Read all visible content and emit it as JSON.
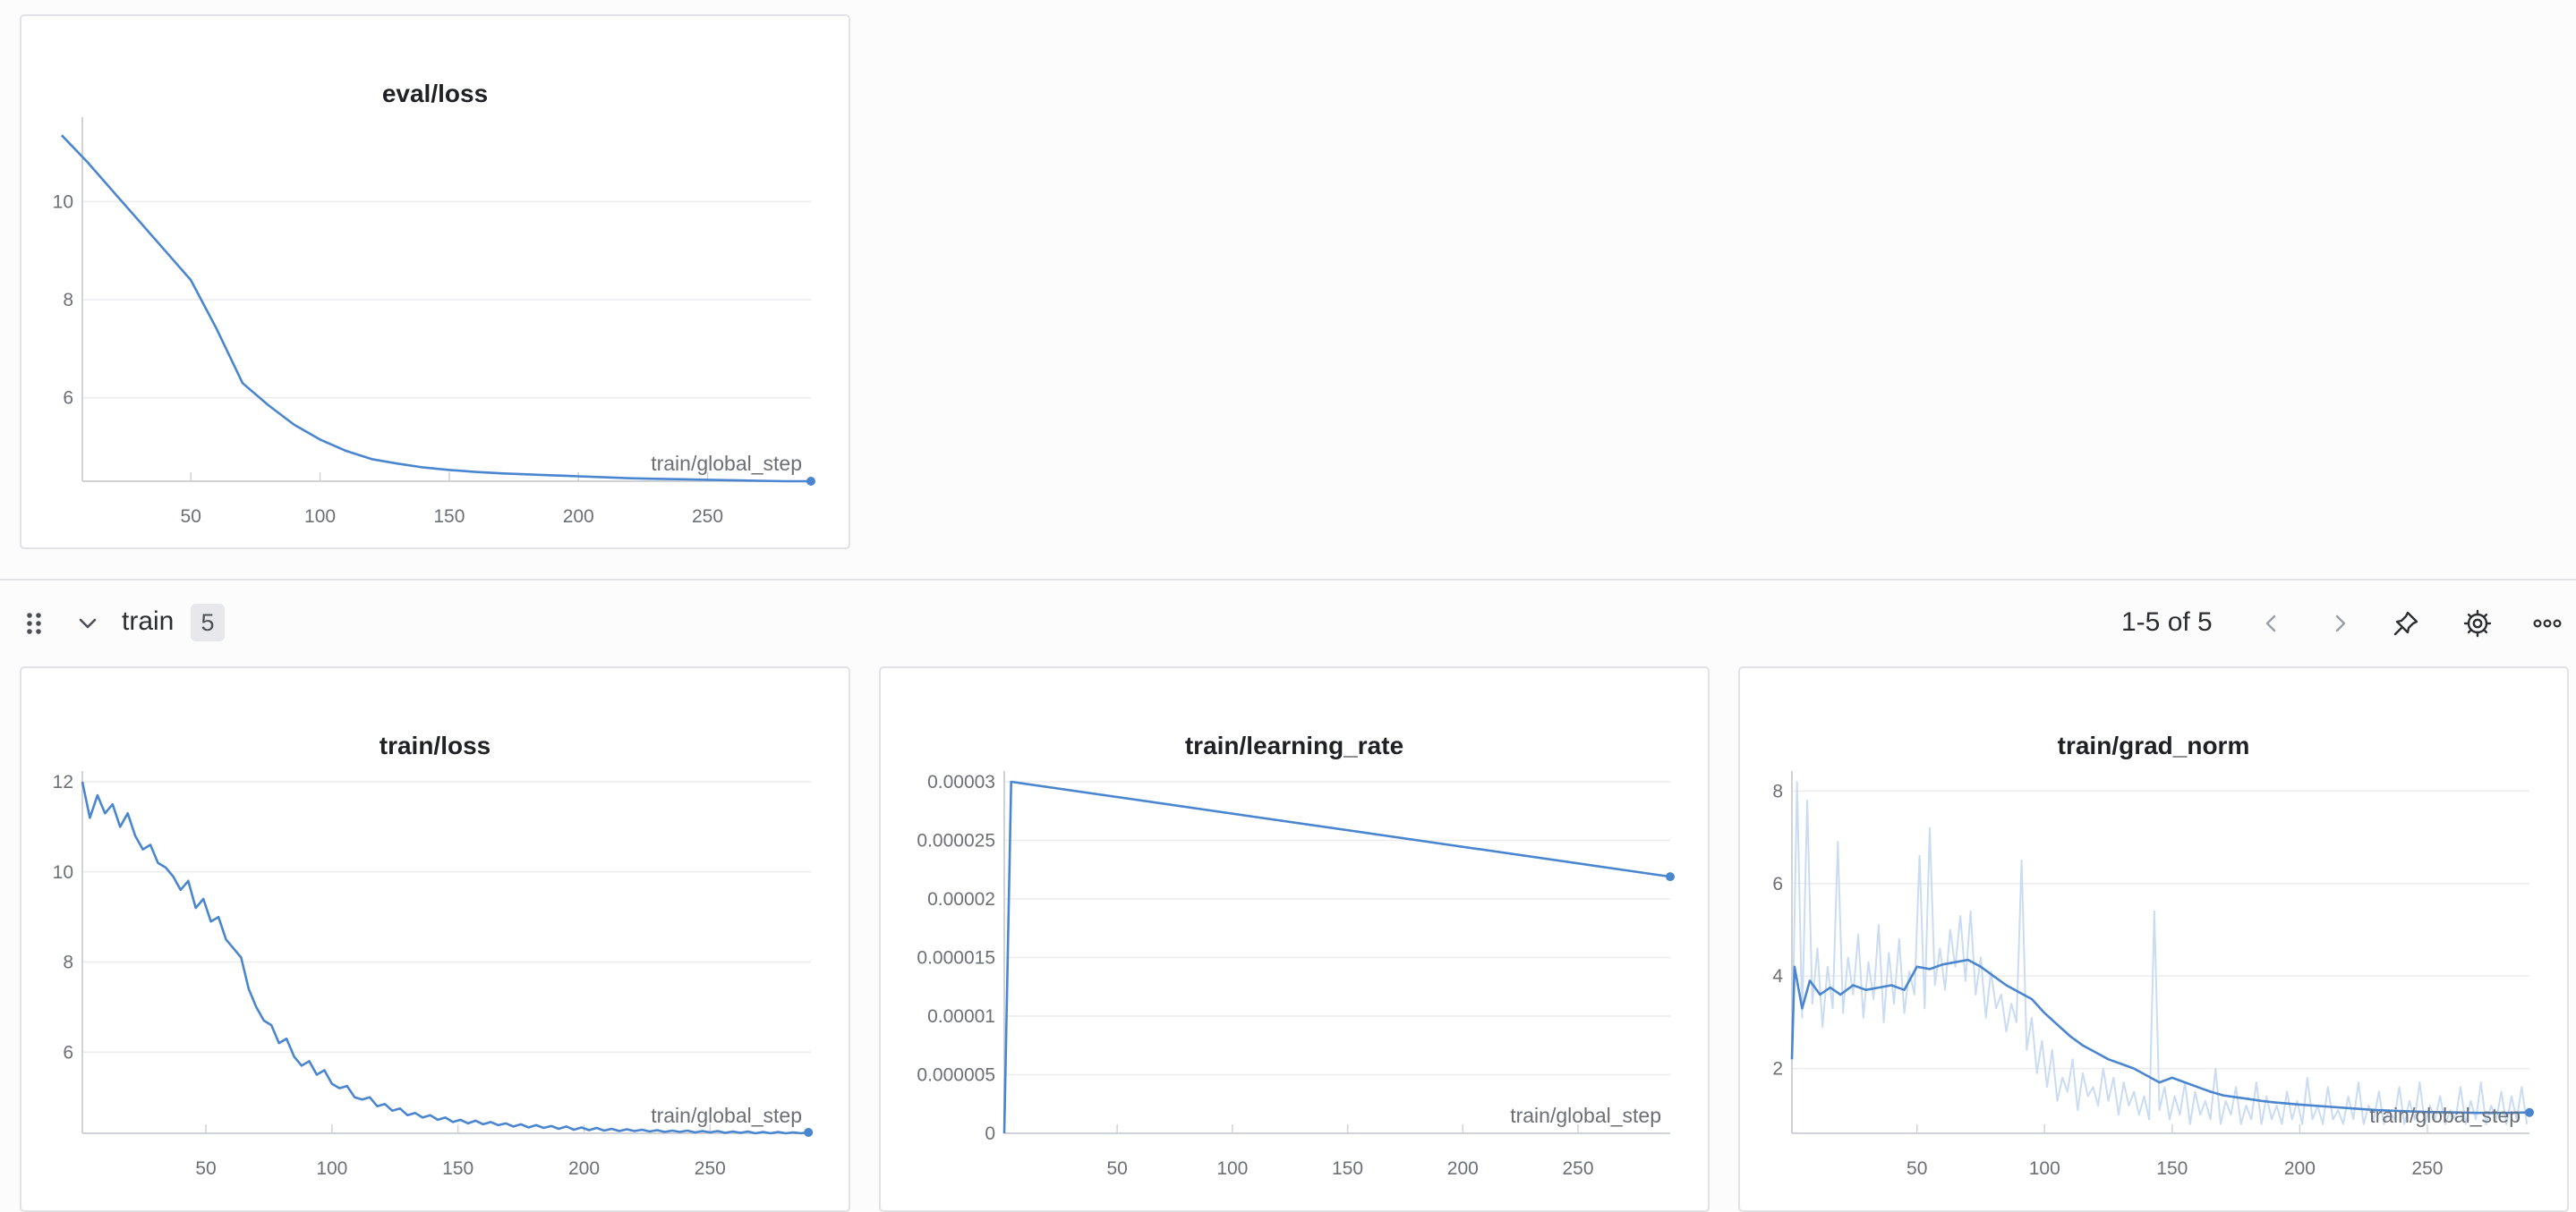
{
  "section": {
    "title": "train",
    "count": "5",
    "pagination": "1-5 of 5"
  },
  "icons": {
    "drag": "drag-handle-icon",
    "collapse": "chevron-down-icon",
    "prev": "chevron-left-icon",
    "next": "chevron-right-icon",
    "pin": "pin-icon",
    "settings": "gear-icon",
    "more": "more-horizontal-icon"
  },
  "colors": {
    "line": "#4a86cf",
    "raw_line": "#c9dcf2",
    "grid": "#ececee",
    "axis": "#cfd2d7",
    "text": "#6b6f76"
  },
  "chart_data": [
    {
      "id": "eval_loss",
      "type": "line",
      "title": "eval/loss",
      "xlabel": "train/global_step",
      "ylabel": "",
      "xlim": [
        8,
        290
      ],
      "ylim": [
        4.3,
        11.5
      ],
      "xticks": [
        50,
        100,
        150,
        200,
        250
      ],
      "yticks": [
        6,
        8,
        10
      ],
      "ytick_labels": [
        "6",
        "8",
        "10"
      ],
      "series": [
        {
          "x": [
            0,
            10,
            20,
            30,
            40,
            50,
            60,
            70,
            80,
            90,
            100,
            110,
            120,
            130,
            140,
            150,
            160,
            170,
            180,
            190,
            200,
            210,
            220,
            230,
            240,
            250,
            260,
            270,
            280,
            290
          ],
          "y": [
            11.35,
            10.8,
            10.2,
            9.6,
            9.0,
            8.4,
            7.4,
            6.3,
            5.85,
            5.45,
            5.15,
            4.92,
            4.75,
            4.66,
            4.58,
            4.53,
            4.49,
            4.46,
            4.44,
            4.42,
            4.4,
            4.38,
            4.36,
            4.35,
            4.34,
            4.33,
            4.32,
            4.31,
            4.3,
            4.3
          ]
        }
      ]
    },
    {
      "id": "train_loss",
      "type": "line",
      "title": "train/loss",
      "xlabel": "train/global_step",
      "ylabel": "",
      "xlim": [
        1,
        290
      ],
      "ylim": [
        4.2,
        12
      ],
      "xticks": [
        50,
        100,
        150,
        200,
        250
      ],
      "yticks": [
        6,
        8,
        10,
        12
      ],
      "ytick_labels": [
        "6",
        "8",
        "10",
        "12"
      ],
      "series": [
        {
          "x": [
            1,
            4,
            7,
            10,
            13,
            16,
            19,
            22,
            25,
            28,
            31,
            34,
            37,
            40,
            43,
            46,
            49,
            52,
            55,
            58,
            61,
            64,
            67,
            70,
            73,
            76,
            79,
            82,
            85,
            88,
            91,
            94,
            97,
            100,
            103,
            106,
            109,
            112,
            115,
            118,
            121,
            124,
            127,
            130,
            133,
            136,
            139,
            142,
            145,
            148,
            151,
            154,
            157,
            160,
            163,
            166,
            169,
            172,
            175,
            178,
            181,
            184,
            187,
            190,
            193,
            196,
            199,
            202,
            205,
            208,
            211,
            214,
            217,
            220,
            223,
            226,
            229,
            232,
            235,
            238,
            241,
            244,
            247,
            250,
            253,
            256,
            259,
            262,
            265,
            268,
            271,
            274,
            277,
            280,
            283,
            286,
            289
          ],
          "y": [
            12.0,
            11.2,
            11.7,
            11.3,
            11.5,
            11.0,
            11.3,
            10.8,
            10.5,
            10.6,
            10.2,
            10.1,
            9.9,
            9.6,
            9.8,
            9.2,
            9.4,
            8.9,
            9.0,
            8.5,
            8.3,
            8.1,
            7.4,
            7.0,
            6.7,
            6.6,
            6.2,
            6.3,
            5.9,
            5.7,
            5.8,
            5.5,
            5.6,
            5.3,
            5.2,
            5.25,
            5.0,
            4.95,
            5.0,
            4.8,
            4.85,
            4.7,
            4.75,
            4.6,
            4.65,
            4.55,
            4.6,
            4.5,
            4.55,
            4.45,
            4.5,
            4.42,
            4.48,
            4.4,
            4.45,
            4.38,
            4.42,
            4.35,
            4.4,
            4.33,
            4.38,
            4.32,
            4.36,
            4.3,
            4.35,
            4.28,
            4.33,
            4.27,
            4.32,
            4.26,
            4.3,
            4.25,
            4.29,
            4.25,
            4.28,
            4.24,
            4.27,
            4.23,
            4.26,
            4.23,
            4.26,
            4.22,
            4.25,
            4.22,
            4.25,
            4.21,
            4.24,
            4.21,
            4.24,
            4.2,
            4.23,
            4.2,
            4.23,
            4.2,
            4.22,
            4.2,
            4.22
          ]
        }
      ]
    },
    {
      "id": "train_learning_rate",
      "type": "line",
      "title": "train/learning_rate",
      "xlabel": "train/global_step",
      "ylabel": "",
      "xlim": [
        1,
        290
      ],
      "ylim": [
        0,
        3e-05
      ],
      "xticks": [
        50,
        100,
        150,
        200,
        250
      ],
      "yticks": [
        0,
        5e-06,
        1e-05,
        1.5e-05,
        2e-05,
        2.5e-05,
        3e-05
      ],
      "ytick_labels": [
        "0",
        "0.000005",
        "0.00001",
        "0.000015",
        "0.00002",
        "0.000025",
        "0.00003"
      ],
      "series": [
        {
          "x": [
            1,
            4,
            290
          ],
          "y": [
            0,
            3e-05,
            2.19e-05
          ]
        }
      ]
    },
    {
      "id": "train_grad_norm",
      "type": "line",
      "title": "train/grad_norm",
      "xlabel": "train/global_step",
      "ylabel": "",
      "xlim": [
        1,
        290
      ],
      "ylim": [
        0.6,
        8.2
      ],
      "xticks": [
        50,
        100,
        150,
        200,
        250
      ],
      "yticks": [
        2,
        4,
        6,
        8
      ],
      "ytick_labels": [
        "2",
        "4",
        "6",
        "8"
      ],
      "series": [
        {
          "name": "raw",
          "x": [
            1,
            3,
            5,
            7,
            9,
            11,
            13,
            15,
            17,
            19,
            21,
            23,
            25,
            27,
            29,
            31,
            33,
            35,
            37,
            39,
            41,
            43,
            45,
            47,
            49,
            51,
            53,
            55,
            57,
            59,
            61,
            63,
            65,
            67,
            69,
            71,
            73,
            75,
            77,
            79,
            81,
            83,
            85,
            87,
            89,
            91,
            93,
            95,
            97,
            99,
            101,
            103,
            105,
            107,
            109,
            111,
            113,
            115,
            117,
            119,
            121,
            123,
            125,
            127,
            129,
            131,
            133,
            135,
            137,
            139,
            141,
            143,
            145,
            147,
            149,
            151,
            153,
            155,
            157,
            159,
            161,
            163,
            165,
            167,
            169,
            171,
            173,
            175,
            177,
            179,
            181,
            183,
            185,
            187,
            189,
            191,
            193,
            195,
            197,
            199,
            201,
            203,
            205,
            207,
            209,
            211,
            213,
            215,
            217,
            219,
            221,
            223,
            225,
            227,
            229,
            231,
            233,
            235,
            237,
            239,
            241,
            243,
            245,
            247,
            249,
            251,
            253,
            255,
            257,
            259,
            261,
            263,
            265,
            267,
            269,
            271,
            273,
            275,
            277,
            279,
            281,
            283,
            285,
            287,
            289
          ],
          "y": [
            2.2,
            8.2,
            3.1,
            7.8,
            3.4,
            4.6,
            2.9,
            4.2,
            3.3,
            6.9,
            3.2,
            4.4,
            3.6,
            4.9,
            3.1,
            4.3,
            3.5,
            5.1,
            3.0,
            4.5,
            3.4,
            4.8,
            3.2,
            4.1,
            3.6,
            6.6,
            3.3,
            7.2,
            3.8,
            4.6,
            3.7,
            5.0,
            4.2,
            5.3,
            3.9,
            5.4,
            3.6,
            4.4,
            3.1,
            4.1,
            3.3,
            3.6,
            2.8,
            3.4,
            3.0,
            6.5,
            2.4,
            3.1,
            1.9,
            2.6,
            1.6,
            2.4,
            1.3,
            1.8,
            1.5,
            2.2,
            1.1,
            1.9,
            1.4,
            1.6,
            1.2,
            2.0,
            1.3,
            1.8,
            1.0,
            1.7,
            1.2,
            1.5,
            1.0,
            1.4,
            0.9,
            5.4,
            1.1,
            1.6,
            0.9,
            1.4,
            1.0,
            1.7,
            0.8,
            1.5,
            1.0,
            1.3,
            0.9,
            2.0,
            0.8,
            1.3,
            1.0,
            1.6,
            0.8,
            1.2,
            0.9,
            1.7,
            0.8,
            1.4,
            0.9,
            1.2,
            0.8,
            1.5,
            0.9,
            1.3,
            0.8,
            1.8,
            0.9,
            1.2,
            0.8,
            1.6,
            0.9,
            1.1,
            0.8,
            1.4,
            0.9,
            1.7,
            0.8,
            1.2,
            0.9,
            1.5,
            0.8,
            1.1,
            0.9,
            1.6,
            0.8,
            1.3,
            0.9,
            1.7,
            0.8,
            1.2,
            0.9,
            1.4,
            0.8,
            1.1,
            0.9,
            1.6,
            0.8,
            1.3,
            0.9,
            1.7,
            0.8,
            1.2,
            0.9,
            1.5,
            0.8,
            1.4,
            0.9,
            1.6,
            0.8
          ]
        },
        {
          "name": "smoothed",
          "x": [
            1,
            2,
            5,
            8,
            12,
            16,
            20,
            25,
            30,
            35,
            40,
            45,
            50,
            55,
            60,
            65,
            70,
            75,
            80,
            85,
            90,
            95,
            100,
            105,
            110,
            115,
            120,
            125,
            130,
            135,
            140,
            145,
            150,
            155,
            160,
            165,
            170,
            175,
            180,
            185,
            190,
            200,
            210,
            220,
            230,
            240,
            250,
            260,
            270,
            280,
            290
          ],
          "y": [
            2.2,
            4.2,
            3.3,
            3.9,
            3.6,
            3.75,
            3.6,
            3.8,
            3.7,
            3.75,
            3.8,
            3.7,
            4.2,
            4.15,
            4.25,
            4.3,
            4.35,
            4.2,
            4.0,
            3.8,
            3.65,
            3.5,
            3.2,
            2.95,
            2.7,
            2.5,
            2.35,
            2.2,
            2.1,
            2.0,
            1.85,
            1.7,
            1.8,
            1.7,
            1.6,
            1.5,
            1.42,
            1.38,
            1.34,
            1.3,
            1.27,
            1.22,
            1.18,
            1.14,
            1.1,
            1.08,
            1.06,
            1.05,
            1.04,
            1.04,
            1.05
          ]
        }
      ]
    }
  ]
}
